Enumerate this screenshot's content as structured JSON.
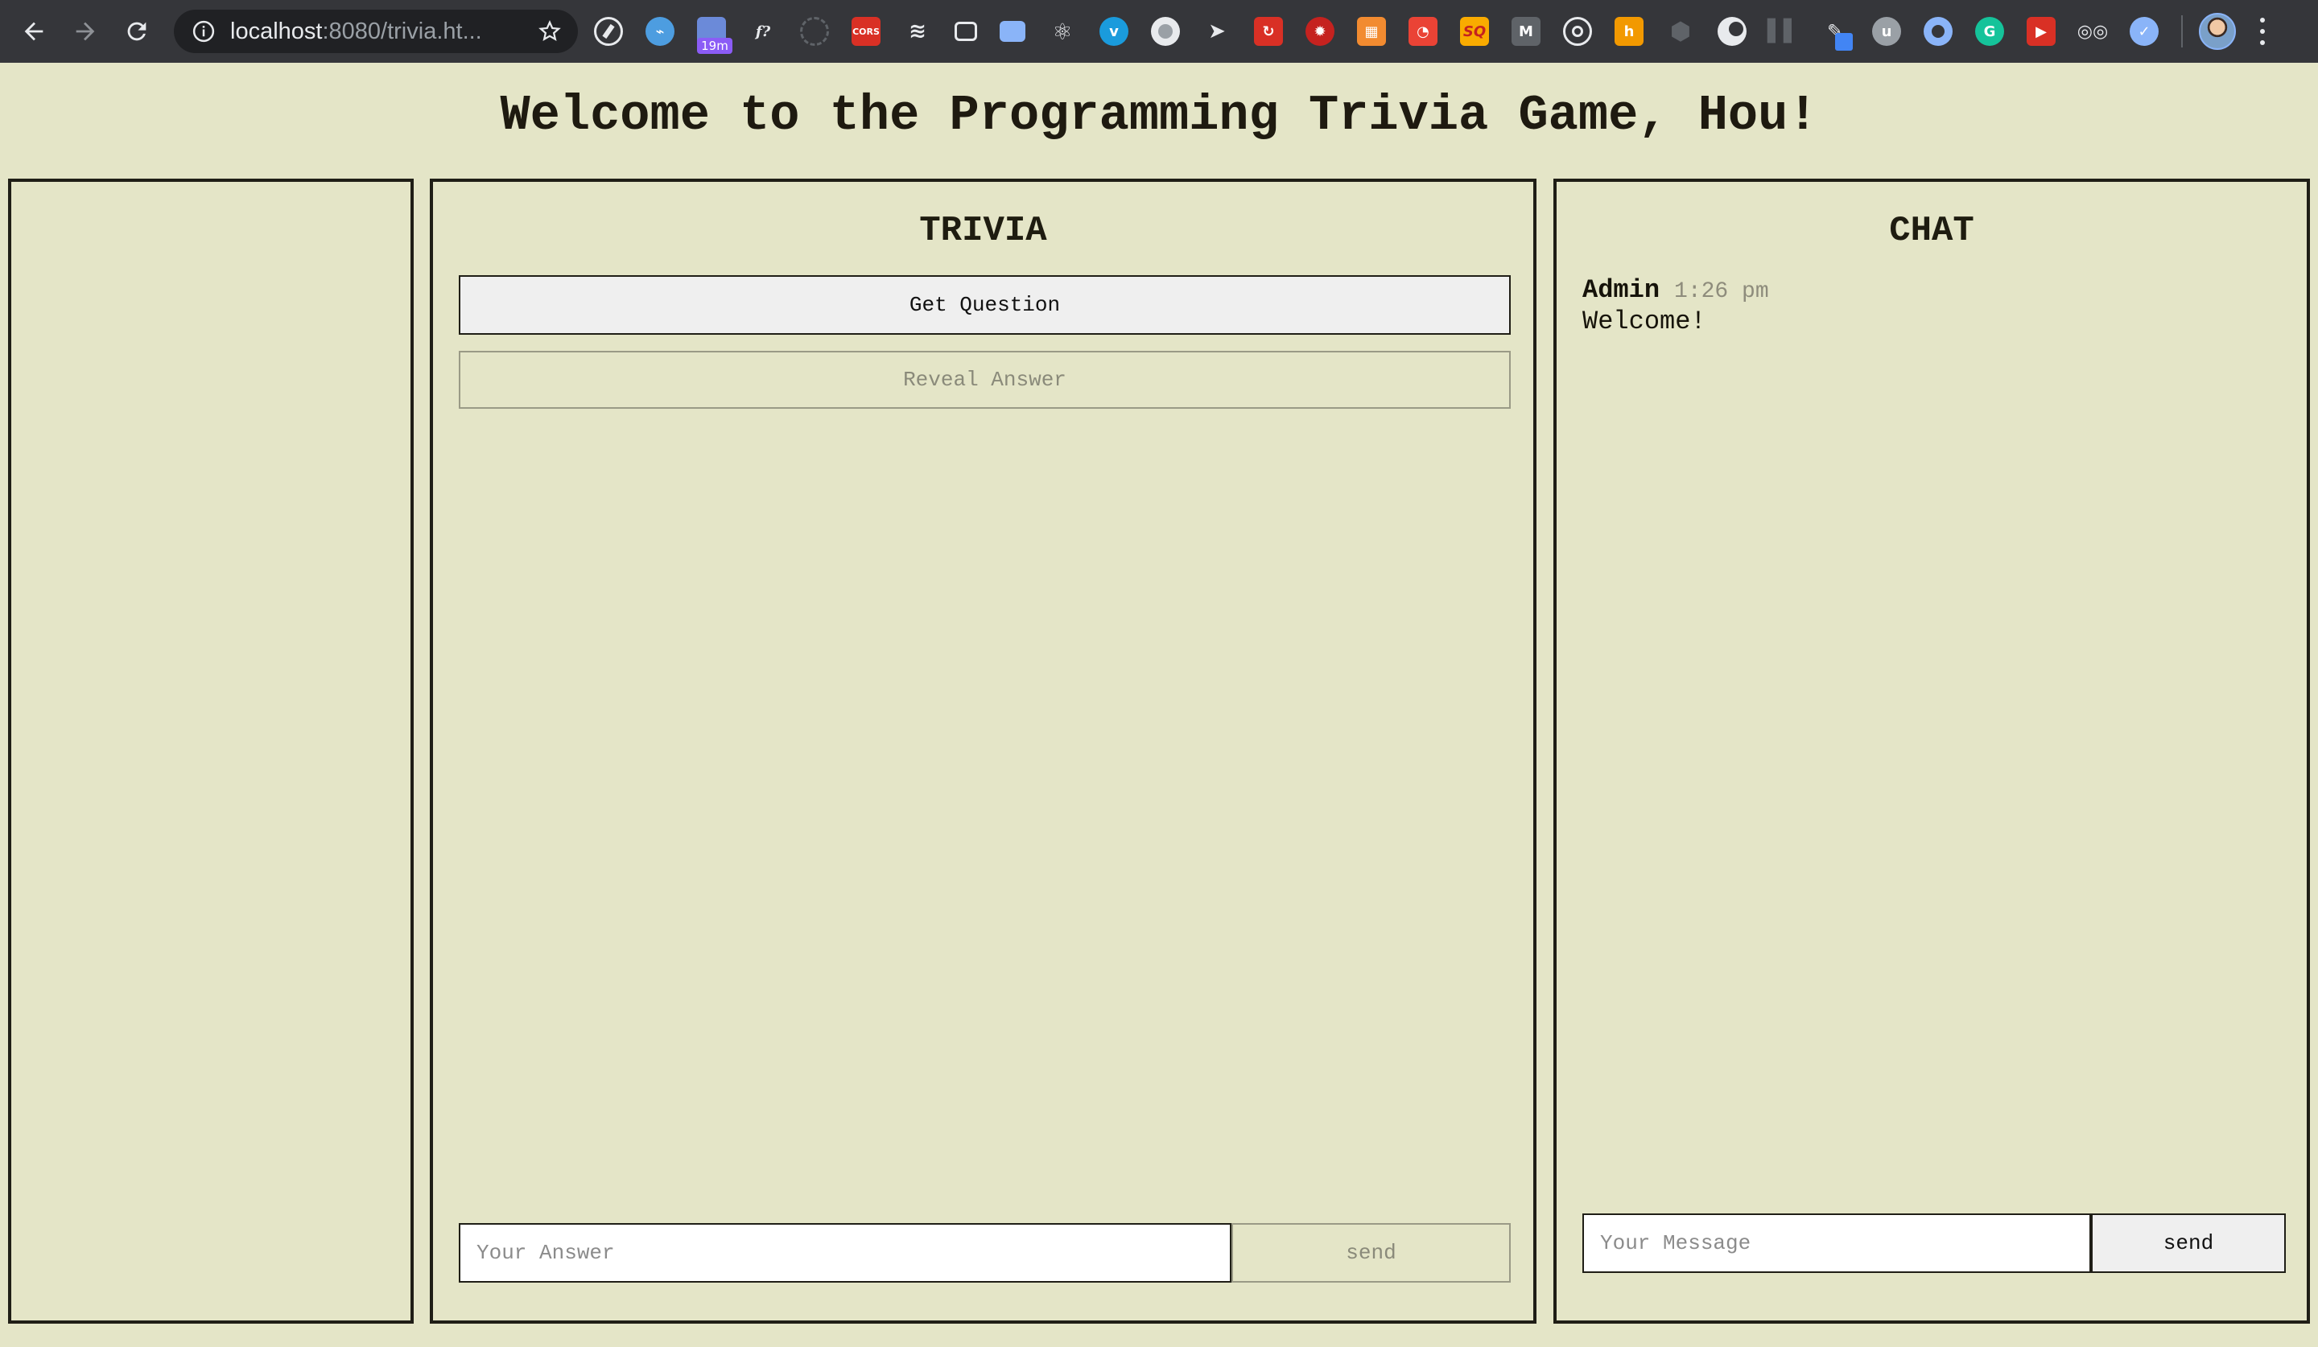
{
  "browser": {
    "url_host": "localhost",
    "url_rest": ":8080/trivia.ht...",
    "back_icon": "arrow-left",
    "forward_icon": "arrow-right",
    "reload_icon": "reload",
    "extension_badge": "19m",
    "extensions": [
      "compass-icon",
      "vscode-icon",
      "calendar-icon",
      "function-icon",
      "clock-icon",
      "cors-icon",
      "layers-icon",
      "windows-icon",
      "card-icon",
      "react-icon",
      "vimeo-icon",
      "circle-icon",
      "cursor-icon",
      "refresh-red-icon",
      "gear-red-icon",
      "grid-icon",
      "chart-icon",
      "sq-icon",
      "m-icon",
      "target-icon",
      "h-icon",
      "hexagon-icon",
      "crescent-icon",
      "bars-icon",
      "eyedropper-icon",
      "u-icon",
      "onion-icon",
      "grammarly-icon",
      "play-red-icon",
      "glasses-icon",
      "shield-icon"
    ]
  },
  "page": {
    "title": "Welcome to the Programming Trivia Game, Hou!"
  },
  "trivia": {
    "heading": "TRIVIA",
    "get_question": "Get Question",
    "reveal_answer": "Reveal Answer",
    "answer_placeholder": "Your Answer",
    "send_label": "send"
  },
  "chat": {
    "heading": "CHAT",
    "messages": [
      {
        "author": "Admin",
        "time": "1:26 pm",
        "text": "Welcome!"
      }
    ],
    "message_placeholder": "Your Message",
    "send_label": "send"
  },
  "colors": {
    "background": "#e4e5c7",
    "border": "#1f1e16",
    "chrome": "#35363a"
  }
}
